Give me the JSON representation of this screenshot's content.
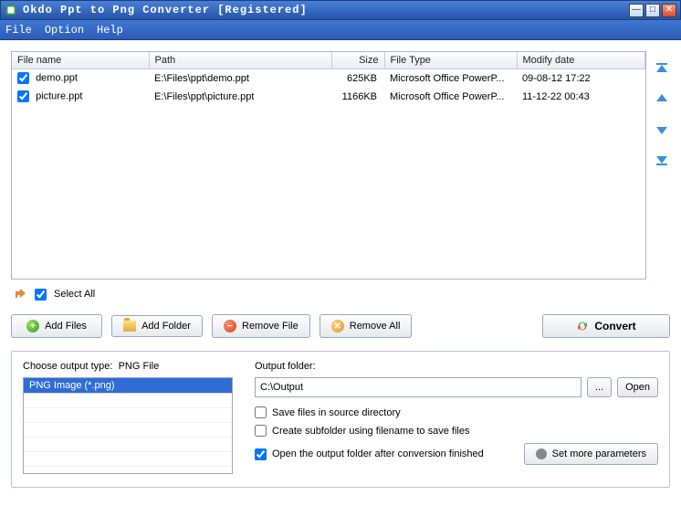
{
  "window": {
    "title": "Okdo Ppt to Png Converter [Registered]"
  },
  "menu": {
    "file": "File",
    "option": "Option",
    "help": "Help"
  },
  "table": {
    "headers": {
      "filename": "File name",
      "path": "Path",
      "size": "Size",
      "filetype": "File Type",
      "modify": "Modify date"
    },
    "rows": [
      {
        "filename": "demo.ppt",
        "path": "E:\\Files\\ppt\\demo.ppt",
        "size": "625KB",
        "filetype": "Microsoft Office PowerP...",
        "modify": "09-08-12 17:22"
      },
      {
        "filename": "picture.ppt",
        "path": "E:\\Files\\ppt\\picture.ppt",
        "size": "1166KB",
        "filetype": "Microsoft Office PowerP...",
        "modify": "11-12-22 00:43"
      }
    ]
  },
  "selectall": {
    "label": "Select All"
  },
  "buttons": {
    "addFiles": "Add Files",
    "addFolder": "Add Folder",
    "removeFile": "Remove File",
    "removeAll": "Remove All",
    "convert": "Convert",
    "browse": "...",
    "open": "Open",
    "setParams": "Set more parameters"
  },
  "outputType": {
    "label": "Choose output type:",
    "current": "PNG File",
    "listItem": "PNG Image (*.png)"
  },
  "outputFolder": {
    "label": "Output folder:",
    "value": "C:\\Output"
  },
  "checks": {
    "saveInSource": "Save files in source directory",
    "createSubfolder": "Create subfolder using filename to save files",
    "openAfter": "Open the output folder after conversion finished"
  }
}
